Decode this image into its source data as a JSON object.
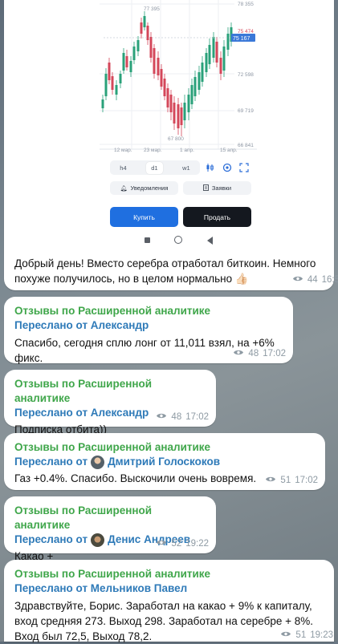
{
  "screenshot": {
    "price_labels": [
      "78 355",
      "75 474",
      "75 167",
      "72 598",
      "69 719",
      "66 841"
    ],
    "high_label": "77 395",
    "low_label": "67 800",
    "date_labels": [
      "12 мар.",
      "23 мар.",
      "1 апр.",
      "15 апр."
    ],
    "timeframes": [
      "h4",
      "d1",
      "w1"
    ],
    "active_timeframe": "d1",
    "notifications_label": "Уведомления",
    "orders_label": "Заявки",
    "buy_label": "Купить",
    "sell_label": "Продать"
  },
  "messages": [
    {
      "text": "Добрый день! Вместо серебра отработал биткоин. Немного похуже получилось, но в целом нормально 👍🏻",
      "views": "44",
      "time": "16:5"
    },
    {
      "source": "Отзывы по Расширенной аналитике",
      "forwarded": "Переслано от Александр",
      "text": "Спасибо, сегодня сплю лонг от 11,011 взял, на +6% фикс.",
      "views": "48",
      "time": "17:02"
    },
    {
      "source": "Отзывы по Расширенной аналитике",
      "forwarded": "Переслано от Александр",
      "text": "Подписка отбита))",
      "views": "48",
      "time": "17:02"
    },
    {
      "source": "Отзывы по Расширенной аналитике",
      "forwarded_prefix": "Переслано от",
      "forwarded_name": "Дмитрий Голоскоков",
      "text": "Газ +0.4%. Спасибо. Выскочили очень вовремя.",
      "views": "51",
      "time": "17:02"
    },
    {
      "source": "Отзывы по Расширенной аналитике",
      "forwarded_prefix": "Переслано от",
      "forwarded_name": "Денис Андреев",
      "text": "Какао +",
      "views": "52",
      "time": "19:22"
    },
    {
      "source": "Отзывы по Расширенной аналитике",
      "forwarded": "Переслано от Мельников Павел",
      "text": "Здравствуйте, Борис. Заработал на какао + 9% к капиталу, вход средняя 273. Выход 298.  Заработал на серебре + 8%. Вход был 72,5, Выход 78,2.",
      "views": "51",
      "time": "19:23"
    }
  ],
  "colors": {
    "accent_green": "#3fa64a",
    "link_blue": "#2e7ab8",
    "buy_button": "#1f6fe0",
    "sell_button": "#14181f",
    "candle_up": "#2aa17a",
    "candle_down": "#d4475a"
  }
}
